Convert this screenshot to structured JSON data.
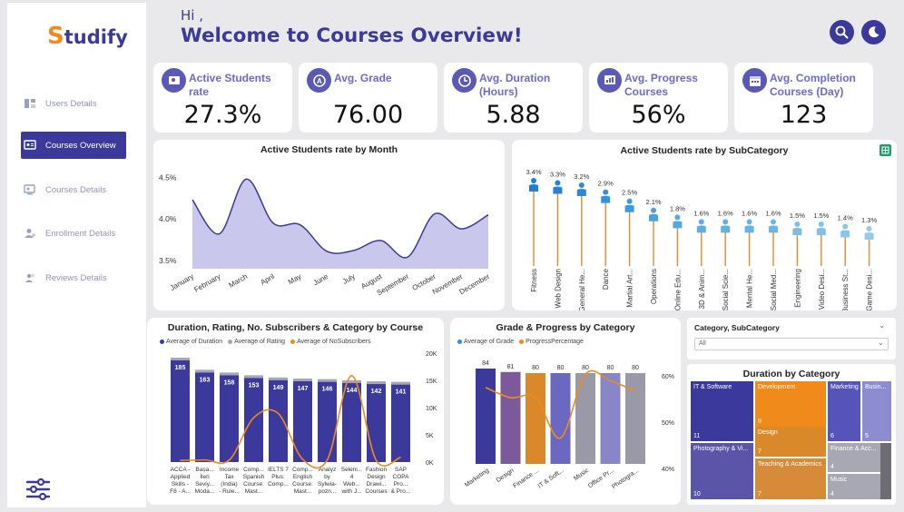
{
  "sidebar": {
    "logo_first": "S",
    "logo_rest": "tudify",
    "items": [
      {
        "label": "Users Details"
      },
      {
        "label": "Courses Overview"
      },
      {
        "label": "Courses Details"
      },
      {
        "label": "Enrollment Details"
      },
      {
        "label": "Reviews Details"
      }
    ]
  },
  "header": {
    "greeting": "Hi ,",
    "title": "Welcome to Courses Overview!"
  },
  "kpis": [
    {
      "label_1": "Active Students",
      "label_2": "rate",
      "value": "27.3%"
    },
    {
      "label_1": "Avg. Grade",
      "label_2": "",
      "value": "76.00"
    },
    {
      "label_1": "Avg. Duration",
      "label_2": "(Hours)",
      "value": "5.88"
    },
    {
      "label_1": "Avg. Progress",
      "label_2": "Courses",
      "value": "56%"
    },
    {
      "label_1": "Avg. Completion",
      "label_2": "Courses (Day)",
      "value": "123"
    }
  ],
  "colors": {
    "brand": "#3b3a9c",
    "orange": "#f08a1a",
    "line": "#3b3a9c",
    "area": "#c9c7ec"
  },
  "chart_data": [
    {
      "type": "area",
      "title": "Active Students rate by Month",
      "categories": [
        "January",
        "February",
        "March",
        "April",
        "May",
        "June",
        "July",
        "August",
        "September",
        "October",
        "November",
        "December"
      ],
      "values": [
        4.23,
        3.82,
        4.48,
        3.95,
        3.93,
        3.61,
        3.62,
        3.74,
        3.54,
        4.06,
        3.88,
        4.05
      ],
      "ytick_labels": [
        "4.5%",
        "4.0%",
        "3.5%"
      ],
      "yticks": [
        4.5,
        4.0,
        3.5
      ],
      "ylim": [
        3.4,
        4.68
      ]
    },
    {
      "type": "bar",
      "title": "Active Students rate by SubCategory",
      "categories": [
        "Fitness",
        "Web Design",
        "General He...",
        "Dance",
        "Martial Art...",
        "Operations",
        "Online Edu...",
        "3D & Anim...",
        "Social Scie...",
        "Mental He...",
        "Social Med...",
        "Engineering",
        "Video Desi...",
        "Business St...",
        "Game Desi..."
      ],
      "values": [
        3.4,
        3.3,
        3.2,
        2.9,
        2.5,
        2.1,
        1.8,
        1.6,
        1.6,
        1.6,
        1.6,
        1.5,
        1.5,
        1.4,
        1.3
      ],
      "value_labels": [
        "3.4%",
        "3.3%",
        "3.2%",
        "2.9%",
        "2.5%",
        "2.1%",
        "1.8%",
        "1.6%",
        "1.6%",
        "1.6%",
        "1.6%",
        "1.5%",
        "1.5%",
        "1.4%",
        "1.3%"
      ]
    },
    {
      "type": "bar",
      "title": "Duration, Rating, No. Subscribers & Category by Course",
      "categories": [
        "ACCA - Applied Skills - F8 - A...",
        "Bașa... İleri Seviy... Moda...",
        "Income Tax (India) - Rule...",
        "Comp... Spanish Course: Mast...",
        "IELTS 7 Plus: Comp...",
        "Comp... English Course: Mast...",
        "Analyz by Sylwia- pozn...",
        "Seleni... 4 Web... with J...",
        "Fashion Design Drawi... Courses",
        "SAP COPA Pro... & Pro..."
      ],
      "category_lines": [
        [
          "ACCA -",
          "Applied",
          "Skills -",
          "F8 - A..."
        ],
        [
          "Bașa...",
          "İleri",
          "Seviy...",
          "Moda..."
        ],
        [
          "Income",
          "Tax",
          "(India)",
          "- Rule..."
        ],
        [
          "Comp...",
          "Spanish",
          "Course:",
          "Mast..."
        ],
        [
          "IELTS 7",
          "Plus:",
          "Comp...",
          ""
        ],
        [
          "Comp...",
          "English",
          "Course:",
          "Mast..."
        ],
        [
          "Analyz",
          "by",
          "Sylwia-",
          "pozn..."
        ],
        [
          "Seleni...",
          "4",
          "Web...",
          "with J..."
        ],
        [
          "Fashion",
          "Design",
          "Drawi...",
          "Courses"
        ],
        [
          "SAP",
          "COPA",
          "Pro...",
          "& Pro..."
        ]
      ],
      "series": [
        {
          "name": "Average of Duration",
          "values": [
            185,
            163,
            158,
            153,
            149,
            147,
            146,
            144,
            142,
            141
          ],
          "color": "#3b3a9c"
        },
        {
          "name": "Average of Rating",
          "values": [
            4.5,
            4.6,
            4.4,
            4.6,
            4.7,
            4.5,
            4.4,
            4.6,
            4.5,
            4.4
          ],
          "color": "#a7a7b3"
        },
        {
          "name": "Average of NoSubscribers",
          "values": [
            300,
            400,
            350,
            8200,
            9000,
            500,
            400,
            16000,
            300,
            900
          ],
          "color": "#f08a1a"
        }
      ],
      "y2_ticks": [
        "20K",
        "15K",
        "10K",
        "5K",
        "0K"
      ],
      "y2lim": [
        0,
        20000
      ]
    },
    {
      "type": "bar",
      "title": "Grade & Progress by Category",
      "categories": [
        "Marketing",
        "Design",
        "Finance ...",
        "IT & Soft...",
        "Music",
        "Office Pr...",
        "Photogra..."
      ],
      "series": [
        {
          "name": "Average of Grade",
          "values": [
            84,
            81,
            80,
            80,
            80,
            80,
            80
          ]
        },
        {
          "name": "ProgressPercentage",
          "values": [
            0.58,
            0.55,
            0.55,
            0.43,
            0.62,
            0.6,
            0.57
          ]
        }
      ],
      "bar_colors": [
        "#3b3a9c",
        "#7a5a9a",
        "#d9892a",
        "#6a68c0",
        "#9a99a8",
        "#8886c9",
        "#9a99a8"
      ],
      "y2_ticks": [
        "60%",
        "50%",
        "40%"
      ],
      "y2lim": [
        0.38,
        0.65
      ]
    },
    {
      "type": "heatmap",
      "title": "Duration by Category",
      "cells": [
        {
          "label": "IT & Software",
          "value": "11",
          "color": "#3b3a9c"
        },
        {
          "label": "Development",
          "value": "9",
          "color": "#f08a1a"
        },
        {
          "label": "Marketing",
          "value": "6",
          "color": "#5654b8"
        },
        {
          "label": "Busin...",
          "value": "5",
          "color": "#8e8cd0"
        },
        {
          "label": "Design",
          "value": "7",
          "color": "#d9892a"
        },
        {
          "label": "Finance & Acc...",
          "value": "4",
          "color": "#a8a8b4"
        },
        {
          "label": "Photography & Vi...",
          "value": "10",
          "color": "#5a55a8"
        },
        {
          "label": "Teaching & Academics",
          "value": "7",
          "color": "#d58b38"
        },
        {
          "label": "Music",
          "value": "4",
          "color": "#a8a8b4"
        },
        {
          "label": "",
          "value": "",
          "color": "#6d6d74"
        }
      ]
    }
  ],
  "filter": {
    "label": "Category, SubCategory",
    "value": "All"
  }
}
